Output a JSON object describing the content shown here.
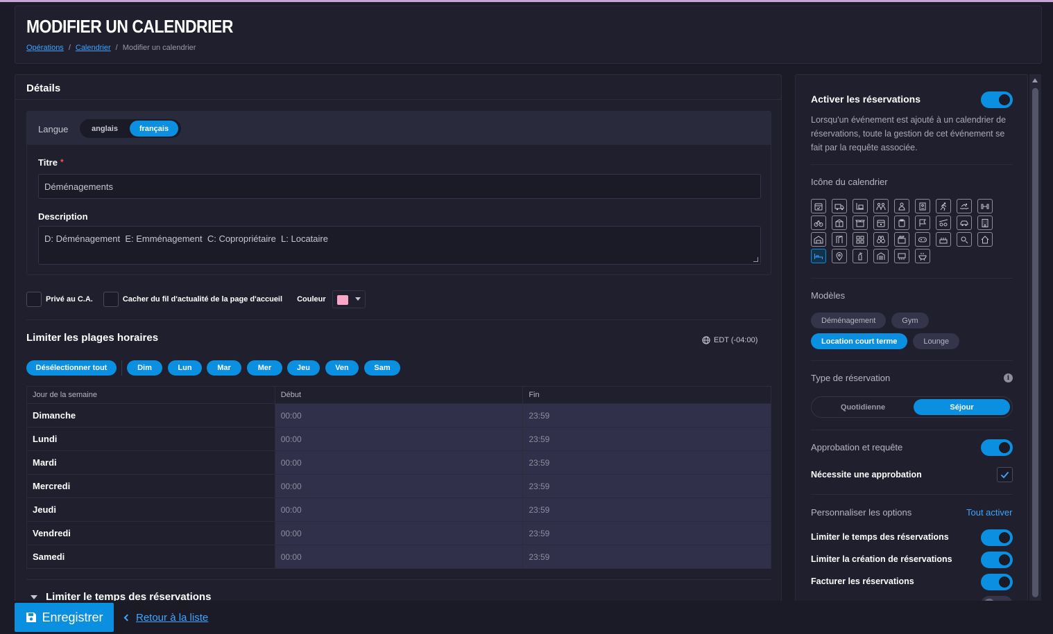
{
  "page": {
    "title": "MODIFIER UN CALENDRIER",
    "breadcrumb": {
      "item1": "Opérations",
      "sep": "/",
      "item2": "Calendrier",
      "current": "Modifier un calendrier"
    }
  },
  "details": {
    "title": "Détails",
    "language_label": "Langue",
    "language_options": [
      "anglais",
      "français"
    ],
    "language_selected": "français",
    "title_label": "Titre",
    "required_mark": "*",
    "title_value": "Déménagements",
    "description_label": "Description",
    "description_value": "D: Déménagement  E: Emménagement  C: Copropriétaire  L: Locataire",
    "private_label": "Privé au C.A.",
    "hide_feed_label": "Cacher du fil d'actualité de la page d'accueil",
    "color_label": "Couleur",
    "color_value": "#f8a7c9"
  },
  "time_slots": {
    "title": "Limiter les plages horaires",
    "timezone": "EDT (-04:00)",
    "deselect_all": "Désélectionner tout",
    "days": [
      "Dim",
      "Lun",
      "Mar",
      "Mer",
      "Jeu",
      "Ven",
      "Sam"
    ],
    "columns": [
      "Jour de la semaine",
      "Début",
      "Fin"
    ],
    "rows": [
      {
        "day": "Dimanche",
        "start": "00:00",
        "end": "23:59"
      },
      {
        "day": "Lundi",
        "start": "00:00",
        "end": "23:59"
      },
      {
        "day": "Mardi",
        "start": "00:00",
        "end": "23:59"
      },
      {
        "day": "Mercredi",
        "start": "00:00",
        "end": "23:59"
      },
      {
        "day": "Jeudi",
        "start": "00:00",
        "end": "23:59"
      },
      {
        "day": "Vendredi",
        "start": "00:00",
        "end": "23:59"
      },
      {
        "day": "Samedi",
        "start": "00:00",
        "end": "23:59"
      }
    ]
  },
  "collapsed_section": "Limiter le temps des réservations",
  "sidebar": {
    "enable_title": "Activer les réservations",
    "enable_on": true,
    "enable_text": "Lorsqu'un événement est ajouté à un calendrier de réservations, toute la gestion de cet événement se fait par la requête associée.",
    "icon_label": "Icône du calendrier",
    "icons": [
      "calendar-check-icon",
      "truck-icon",
      "dolly-icon",
      "people-icon",
      "person-icon",
      "elevator-icon",
      "running-icon",
      "swimming-icon",
      "dumbbell-icon",
      "bicycle-icon",
      "box-icon",
      "open-box-icon",
      "calendar-day-icon",
      "clipboard-icon",
      "flag-icon",
      "bike-rack-icon",
      "car-icon",
      "building-icon",
      "garage-icon",
      "door-icon",
      "grid-icon",
      "binoculars-icon",
      "cinema-icon",
      "game-controller-icon",
      "cake-icon",
      "shower-icon",
      "home-icon",
      "bed-icon",
      "location-pin-icon",
      "fire-extinguisher-icon",
      "storage-icon",
      "tent-icon",
      "bbq-icon"
    ],
    "icon_selected": "bed-icon",
    "models_label": "Modèles",
    "models": [
      "Déménagement",
      "Gym",
      "Location court terme",
      "Lounge"
    ],
    "model_active": "Location court terme",
    "type_label": "Type de réservation",
    "type_options": [
      "Quotidienne",
      "Séjour"
    ],
    "type_selected": "Séjour",
    "approval_label": "Approbation et requête",
    "approval_on": true,
    "needs_approval_label": "Nécessite une approbation",
    "needs_approval_checked": true,
    "customize_label": "Personnaliser les options",
    "enable_all_link": "Tout activer",
    "toggles": [
      {
        "label": "Limiter le temps des réservations",
        "on": true
      },
      {
        "label": "Limiter la création de réservations",
        "on": true
      },
      {
        "label": "Facturer les réservations",
        "on": true
      }
    ]
  },
  "footer": {
    "save": "Enregistrer",
    "back": "Retour à la liste"
  },
  "colors": {
    "accent": "#0b8fe0",
    "link": "#3ea6ff",
    "bg": "#1b1b27",
    "card": "#1f1f2d"
  }
}
